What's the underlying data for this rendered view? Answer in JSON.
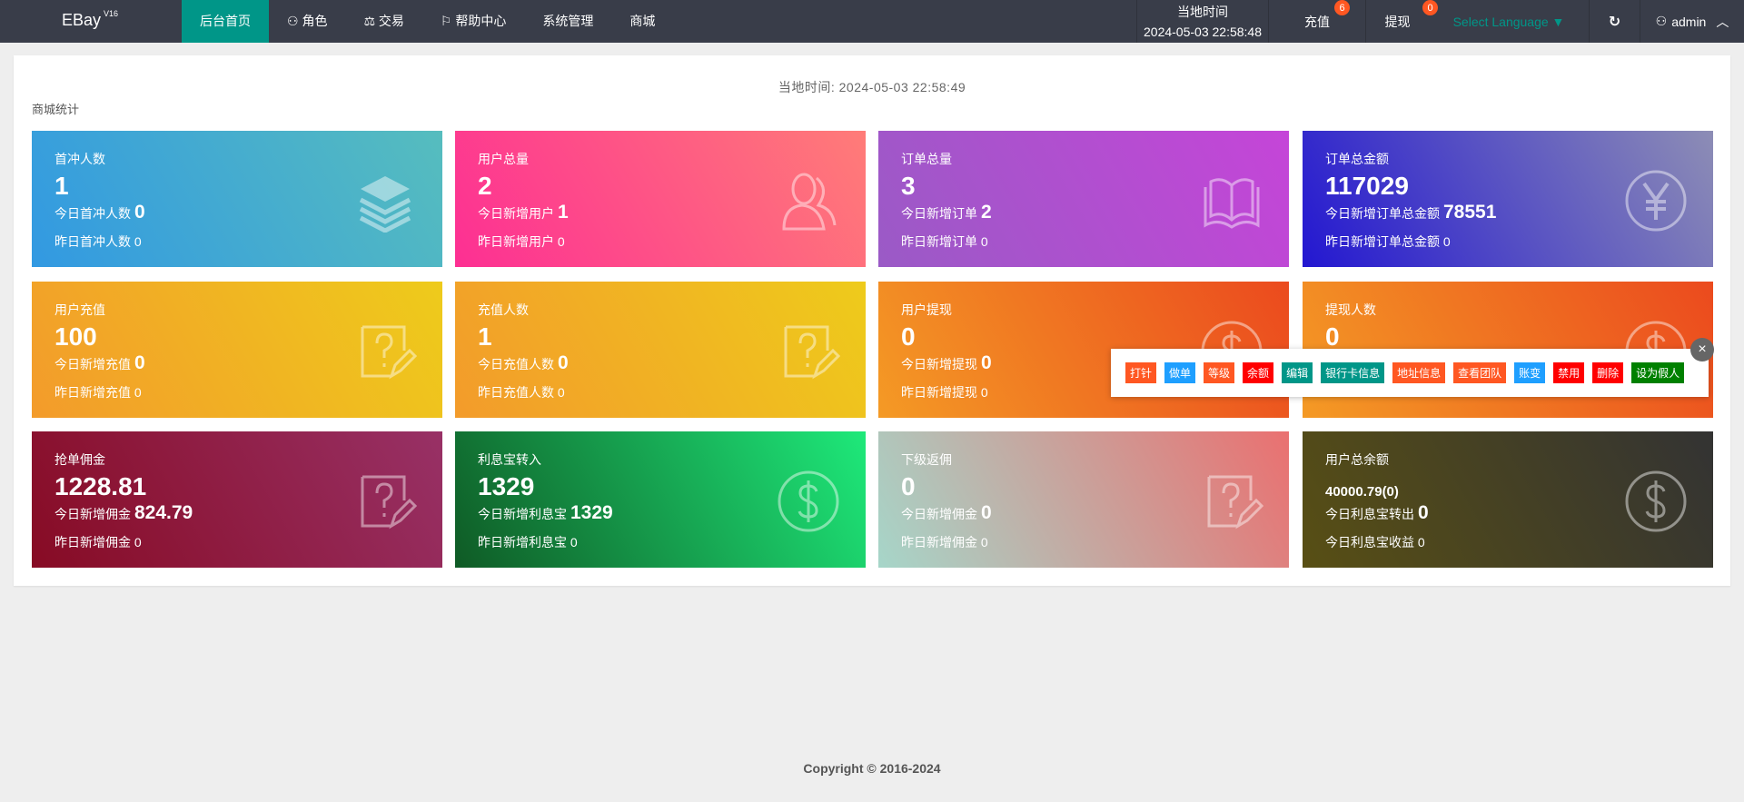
{
  "nav": {
    "brand": "EBay",
    "version": "V16",
    "menu": [
      "后台首页",
      "角色",
      "交易",
      "帮助中心",
      "系统管理",
      "商城"
    ],
    "time_label": "当地时间",
    "time_value": "2024-05-03 22:58:48",
    "recharge": "充值",
    "recharge_badge": "6",
    "withdraw": "提现",
    "withdraw_badge": "0",
    "language": "Select Language ▼",
    "user": "admin"
  },
  "panel": {
    "time_text": "当地时间:  2024-05-03 22:58:49",
    "title": "商城统计"
  },
  "cards": [
    {
      "label": "首冲人数",
      "value": "1",
      "today": "今日首冲人数",
      "today_value": "0",
      "yesterday": "昨日首冲人数 0",
      "icon": "layers",
      "colors": [
        "#3299e2",
        "#56bdbe"
      ]
    },
    {
      "label": "用户总量",
      "value": "2",
      "today": "今日新增用户",
      "today_value": "1",
      "yesterday": "昨日新增用户 0",
      "icon": "users",
      "colors": [
        "#fd2f93",
        "#ff7c78"
      ]
    },
    {
      "label": "订单总量",
      "value": "3",
      "today": "今日新增订单",
      "today_value": "2",
      "yesterday": "昨日新增订单 0",
      "icon": "book",
      "colors": [
        "#9a5ac6",
        "#c545d8"
      ]
    },
    {
      "label": "订单总金额",
      "value": "117029",
      "today": "今日新增订单总金额",
      "today_value": "78551",
      "yesterday": "昨日新增订单总金额 0",
      "icon": "yen",
      "colors": [
        "#2317d1",
        "#8d8db5"
      ]
    },
    {
      "label": "用户充值",
      "value": "100",
      "today": "今日新增充值",
      "today_value": "0",
      "yesterday": "昨日新增充值 0",
      "icon": "edit",
      "colors": [
        "#f39b2b",
        "#eecb1b"
      ]
    },
    {
      "label": "充值人数",
      "value": "1",
      "today": "今日充值人数",
      "today_value": "0",
      "yesterday": "昨日充值人数 0",
      "icon": "edit",
      "colors": [
        "#f39b2b",
        "#eecb1b"
      ]
    },
    {
      "label": "用户提现",
      "value": "0",
      "today": "今日新增提现",
      "today_value": "0",
      "yesterday": "昨日新增提现 0",
      "icon": "dollar",
      "colors": [
        "#f49a25",
        "#eb4a1e"
      ]
    },
    {
      "label": "提现人数",
      "value": "0",
      "today": "",
      "today_value": "",
      "yesterday": "",
      "icon": "dollar",
      "colors": [
        "#f49a25",
        "#eb4a1e"
      ]
    },
    {
      "label": "抢单佣金",
      "value": "1228.81",
      "today": "今日新增佣金",
      "today_value": "824.79",
      "yesterday": "昨日新增佣金 0",
      "icon": "edit",
      "colors": [
        "#870b24",
        "#983166"
      ]
    },
    {
      "label": "利息宝转入",
      "value": "1329",
      "today": "今日新增利息宝",
      "today_value": "1329",
      "yesterday": "昨日新增利息宝 0",
      "icon": "dollar",
      "colors": [
        "#0f5a25",
        "#1ee97a"
      ]
    },
    {
      "label": "下级返佣",
      "value": "0",
      "today": "今日新增佣金",
      "today_value": "0",
      "yesterday": "昨日新增佣金 0",
      "icon": "edit",
      "colors": [
        "#a6d6c9",
        "#ea7070"
      ]
    },
    {
      "label": "用户总余额",
      "value": "40000.79(0)",
      "today": "今日利息宝转出",
      "today_value": "0",
      "yesterday": "今日利息宝收益 0",
      "icon": "dollar",
      "colors": [
        "#584f14",
        "#333333"
      ],
      "small": true
    }
  ],
  "popup": {
    "close": "×",
    "buttons": [
      {
        "label": "打针",
        "color": "#ff5722"
      },
      {
        "label": "做单",
        "color": "#1e9fff"
      },
      {
        "label": "等级",
        "color": "#ff5722"
      },
      {
        "label": "余额",
        "color": "#ff0000"
      },
      {
        "label": "编辑",
        "color": "#009688"
      },
      {
        "label": "银行卡信息",
        "color": "#009688"
      },
      {
        "label": "地址信息",
        "color": "#ff5722"
      },
      {
        "label": "查看团队",
        "color": "#ff5722"
      },
      {
        "label": "账变",
        "color": "#1e9fff"
      },
      {
        "label": "禁用",
        "color": "#ff0000"
      },
      {
        "label": "删除",
        "color": "#ff0000"
      },
      {
        "label": "设为假人",
        "color": "#008000"
      }
    ]
  },
  "footer": "Copyright © 2016-2024"
}
